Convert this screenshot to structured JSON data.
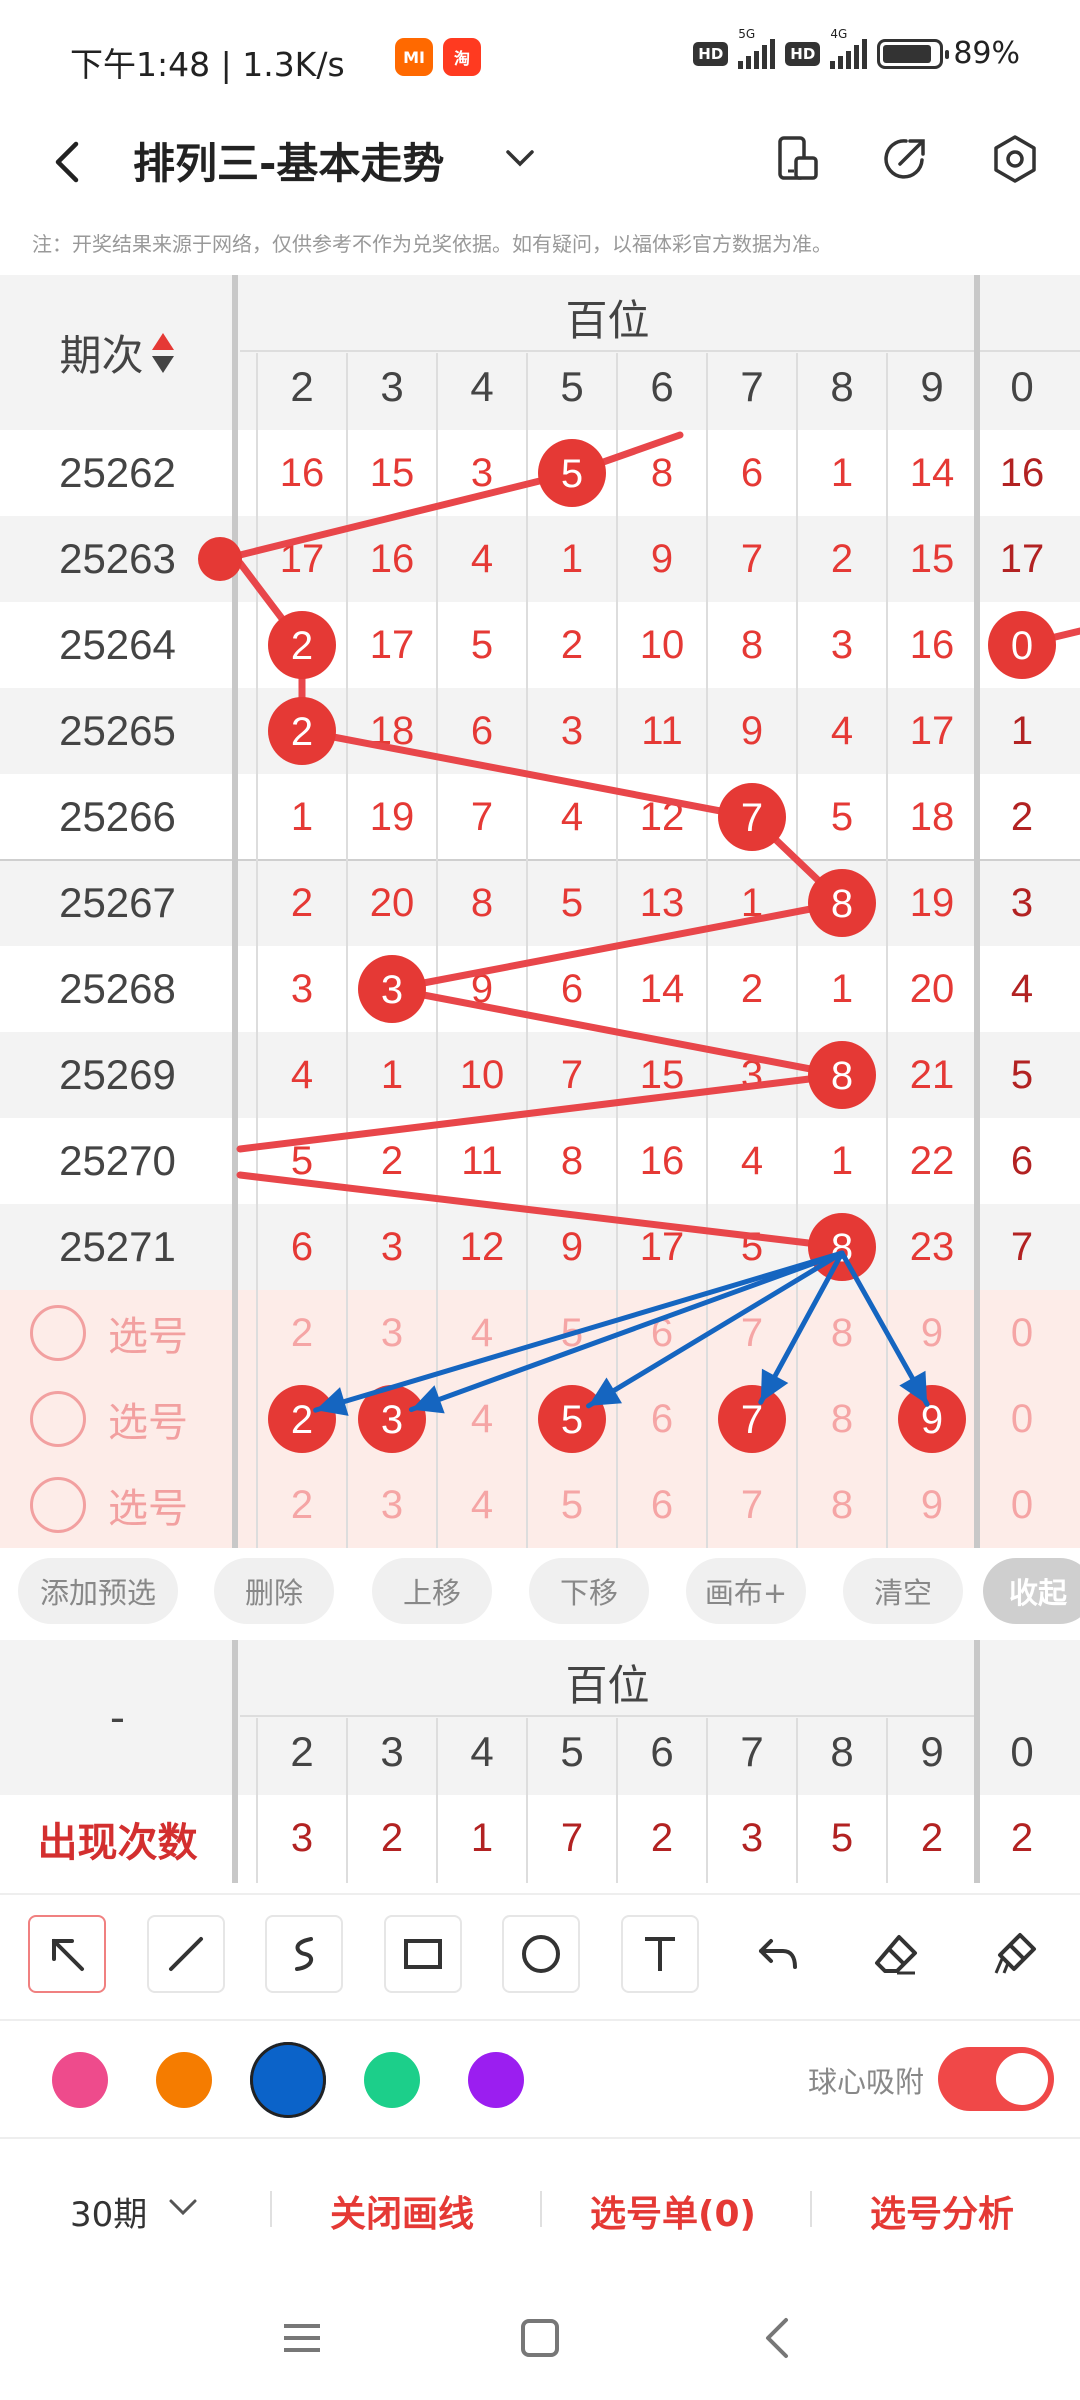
{
  "status": {
    "time": "下午1:48 | 1.3K/s",
    "network_5g": "5G",
    "network_4g": "4G",
    "hd": "HD",
    "battery": "89%",
    "battery_level": 0.89,
    "app_icon_mi": "MI",
    "app_icon_taobao": "淘"
  },
  "header": {
    "title": "排列三-基本走势",
    "icons": [
      "back-icon",
      "chevron-down-icon",
      "device-icon",
      "share-icon",
      "settings-icon"
    ]
  },
  "note": "注：开奖结果来源于网络，仅供参考不作为兑奖依据。如有疑问，以福体彩官方数据为准。",
  "table": {
    "period_header": "期次",
    "group_title": "百位",
    "columns": [
      "2",
      "3",
      "4",
      "5",
      "6",
      "7",
      "8",
      "9",
      "0"
    ],
    "rows": [
      {
        "period": "25262",
        "cells": [
          "16",
          "15",
          "3",
          "5",
          "8",
          "6",
          "1",
          "14",
          "16"
        ]
      },
      {
        "period": "25263",
        "cells": [
          "17",
          "16",
          "4",
          "1",
          "9",
          "7",
          "2",
          "15",
          "17"
        ]
      },
      {
        "period": "25264",
        "cells": [
          "2",
          "17",
          "5",
          "2",
          "10",
          "8",
          "3",
          "16",
          "0"
        ]
      },
      {
        "period": "25265",
        "cells": [
          "2",
          "18",
          "6",
          "3",
          "11",
          "9",
          "4",
          "17",
          "1"
        ]
      },
      {
        "period": "25266",
        "cells": [
          "1",
          "19",
          "7",
          "4",
          "12",
          "7",
          "5",
          "18",
          "2"
        ]
      },
      {
        "period": "25267",
        "cells": [
          "2",
          "20",
          "8",
          "5",
          "13",
          "1",
          "8",
          "19",
          "3"
        ]
      },
      {
        "period": "25268",
        "cells": [
          "3",
          "3",
          "9",
          "6",
          "14",
          "2",
          "1",
          "20",
          "4"
        ]
      },
      {
        "period": "25269",
        "cells": [
          "4",
          "1",
          "10",
          "7",
          "15",
          "3",
          "8",
          "21",
          "5"
        ]
      },
      {
        "period": "25270",
        "cells": [
          "5",
          "2",
          "11",
          "8",
          "16",
          "4",
          "1",
          "22",
          "6"
        ]
      },
      {
        "period": "25271",
        "cells": [
          "6",
          "3",
          "12",
          "9",
          "17",
          "5",
          "8",
          "23",
          "7"
        ]
      }
    ],
    "select_label": "选号",
    "select_rows": [
      {
        "cells": [
          "2",
          "3",
          "4",
          "5",
          "6",
          "7",
          "8",
          "9",
          "0"
        ]
      },
      {
        "cells": [
          "2",
          "3",
          "4",
          "5",
          "6",
          "7",
          "8",
          "9",
          "0"
        ]
      },
      {
        "cells": [
          "2",
          "3",
          "4",
          "5",
          "6",
          "7",
          "8",
          "9",
          "0"
        ]
      }
    ]
  },
  "actions": [
    "添加预选",
    "删除",
    "上移",
    "下移",
    "画布+",
    "清空",
    "收起"
  ],
  "stats": {
    "corner_label": "-",
    "group_title": "百位",
    "columns": [
      "2",
      "3",
      "4",
      "5",
      "6",
      "7",
      "8",
      "9",
      "0"
    ],
    "row_label": "出现次数",
    "values": [
      "3",
      "2",
      "1",
      "7",
      "2",
      "3",
      "5",
      "2",
      "2"
    ]
  },
  "tools": [
    "pointer-tool-icon",
    "line-tool-icon",
    "curve-tool-icon",
    "rectangle-tool-icon",
    "circle-tool-icon",
    "text-tool-icon",
    "undo-icon",
    "eraser-icon",
    "clear-brush-icon"
  ],
  "palette": {
    "colors": [
      "#ee4b8c",
      "#f57c00",
      "#0b63c9",
      "#1ccf8a",
      "#9b1ef0"
    ],
    "selected": "#0b63c9",
    "snap_label": "球心吸附",
    "snap_on": true
  },
  "bottom": {
    "period_select": "30期",
    "close_lines": "关闭画线",
    "pick_list": "选号单(0)",
    "pick_analysis": "选号分析"
  },
  "nav": [
    "menu-icon",
    "home-icon",
    "back-nav-icon"
  ]
}
